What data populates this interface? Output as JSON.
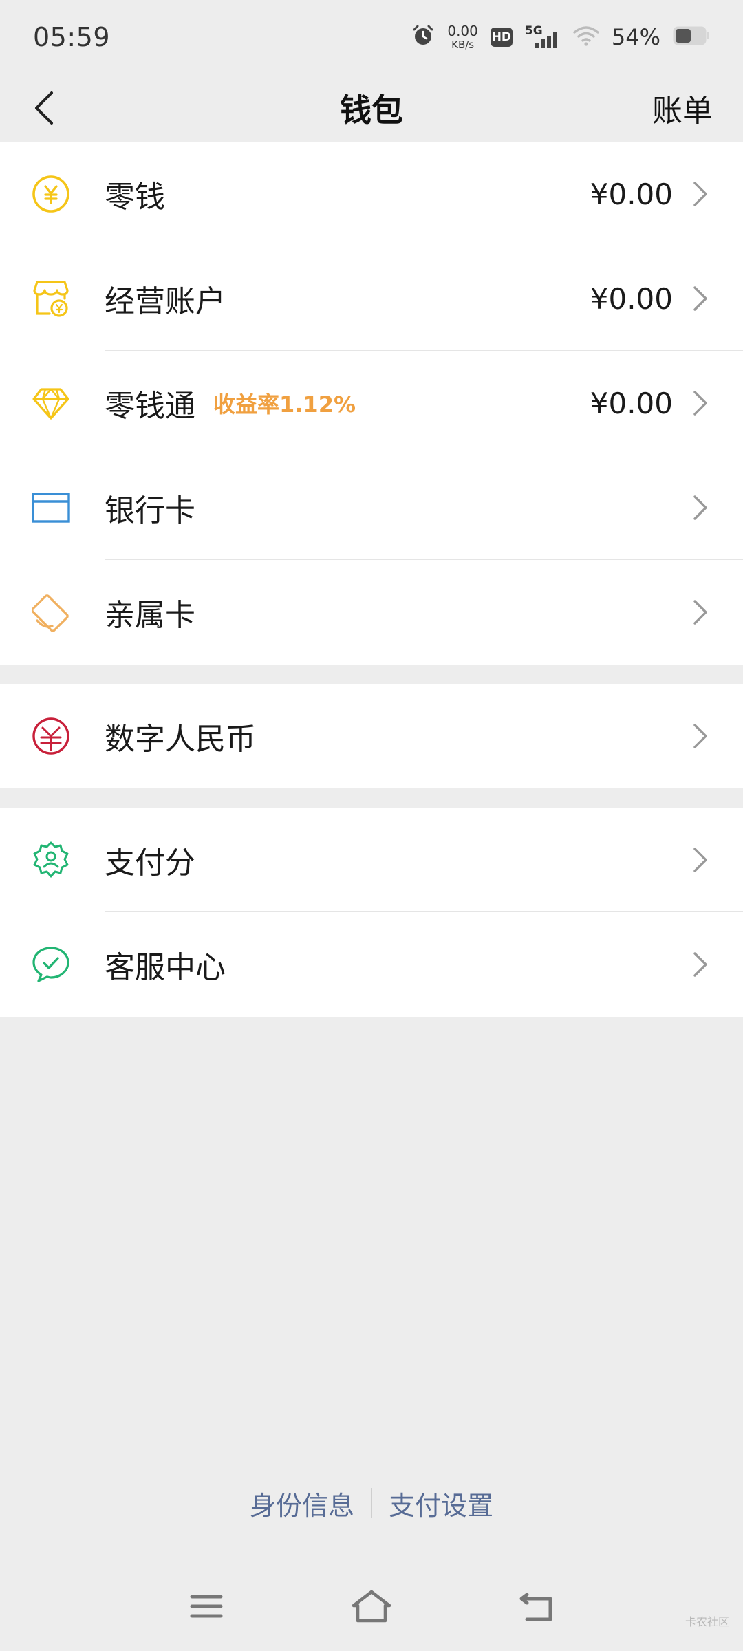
{
  "status_bar": {
    "time": "05:59",
    "net_speed_value": "0.00",
    "net_speed_unit": "KB/s",
    "hd": "HD",
    "network": "5G",
    "battery_percent": "54%",
    "battery_level": 0.54
  },
  "header": {
    "title": "钱包",
    "right_action": "账单"
  },
  "wallet_items": [
    {
      "label": "零钱",
      "value": "¥0.00",
      "icon": "yuan-coin-icon",
      "color": "#f5c518"
    },
    {
      "label": "经营账户",
      "value": "¥0.00",
      "icon": "shop-account-icon",
      "color": "#f5c518"
    },
    {
      "label": "零钱通",
      "badge": "收益率1.12%",
      "value": "¥0.00",
      "icon": "diamond-icon",
      "color": "#f5c518"
    },
    {
      "label": "银行卡",
      "icon": "bank-card-icon",
      "color": "#3a8fd6"
    },
    {
      "label": "亲属卡",
      "icon": "family-card-icon",
      "color": "#f0b060"
    }
  ],
  "digital_items": [
    {
      "label": "数字人民币",
      "icon": "digital-rmb-icon",
      "color": "#c8203a"
    }
  ],
  "service_items": [
    {
      "label": "支付分",
      "icon": "pay-score-icon",
      "color": "#22b573"
    },
    {
      "label": "客服中心",
      "icon": "customer-service-icon",
      "color": "#22b573"
    }
  ],
  "footer": {
    "identity_link": "身份信息",
    "settings_link": "支付设置"
  },
  "watermark": "卡农社区"
}
